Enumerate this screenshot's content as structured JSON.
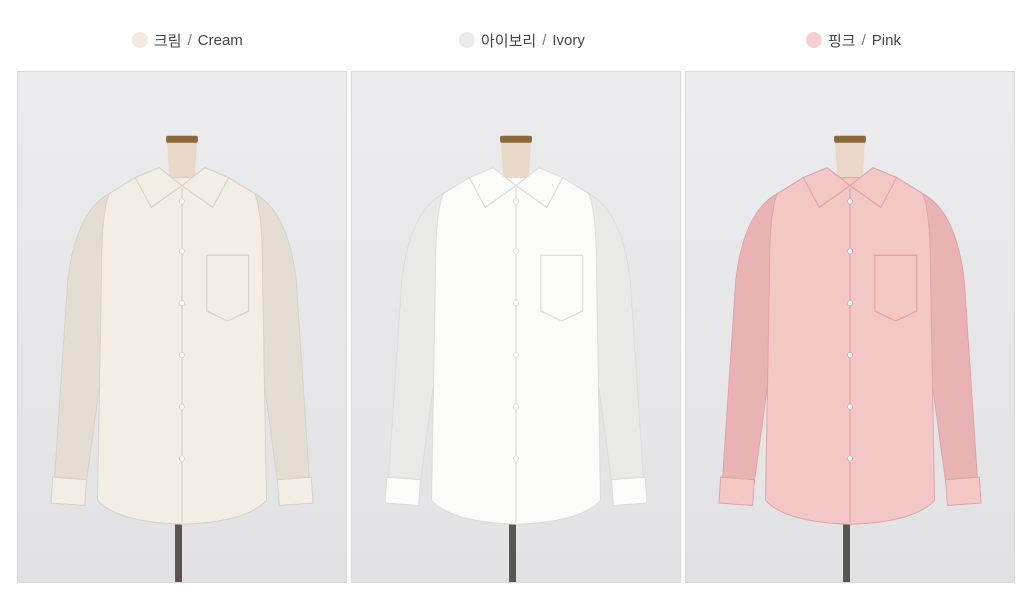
{
  "colors": [
    {
      "ko": "크림",
      "sep": " / ",
      "en": "Cream",
      "swatch": "#f2e8dc",
      "shirt": "#f2eee6",
      "shadow": "#e3ddd2",
      "line": "#d8d1c4"
    },
    {
      "ko": "아이보리",
      "sep": " / ",
      "en": "Ivory",
      "swatch": "#ebebeb",
      "shirt": "#fbfbfa",
      "shadow": "#e9e9e8",
      "line": "#dcdcdb"
    },
    {
      "ko": "핑크",
      "sep": " / ",
      "en": "Pink",
      "swatch": "#f7cfd2",
      "shirt": "#f4c7c7",
      "shadow": "#e9b3b4",
      "line": "#dfa4a5"
    }
  ]
}
